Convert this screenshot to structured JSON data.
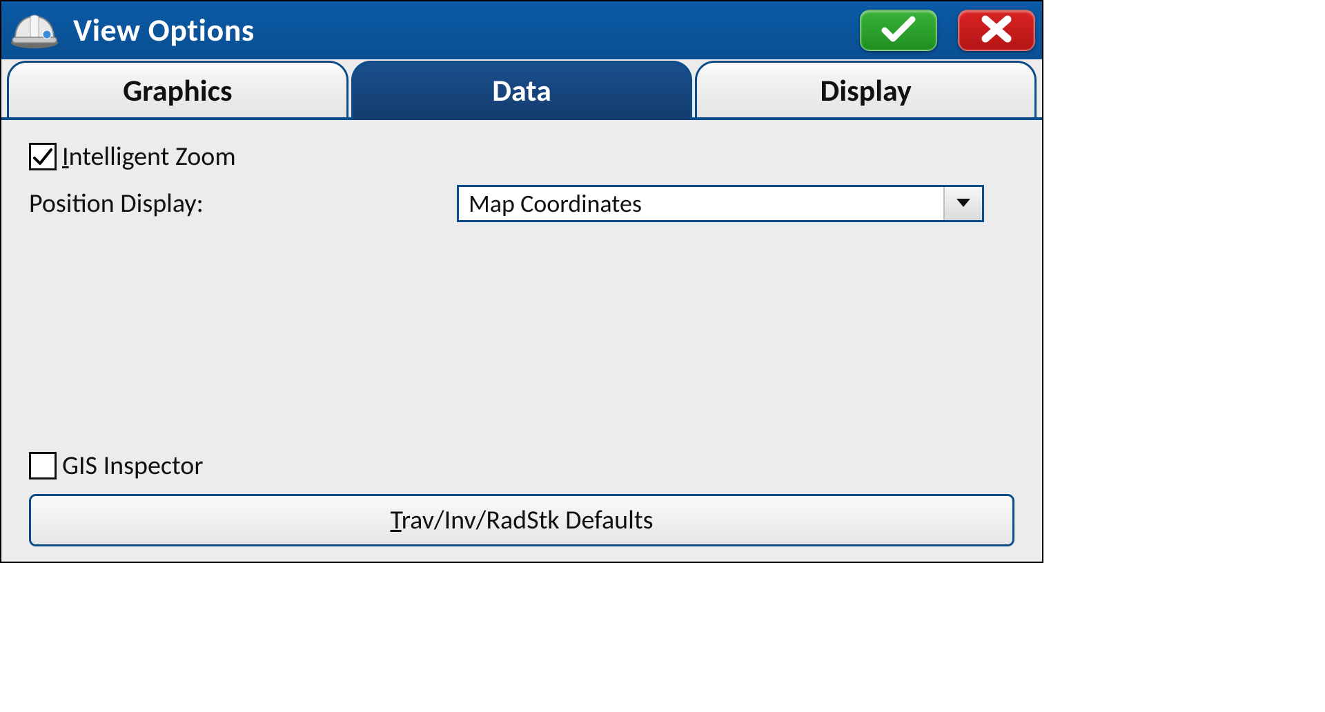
{
  "header": {
    "title": "View Options"
  },
  "tabs": {
    "graphics": "Graphics",
    "data": "Data",
    "display": "Display",
    "active": "data"
  },
  "content": {
    "intelligent_zoom": {
      "label": "ntelligent Zoom",
      "prefix": "I",
      "checked": true
    },
    "position_display": {
      "label": "Position Display:",
      "value": "Map Coordinates"
    },
    "gis_inspector": {
      "label": "GIS Inspector",
      "checked": false
    },
    "defaults_button_prefix": "T",
    "defaults_button_rest": "rav/Inv/RadStk Defaults"
  }
}
